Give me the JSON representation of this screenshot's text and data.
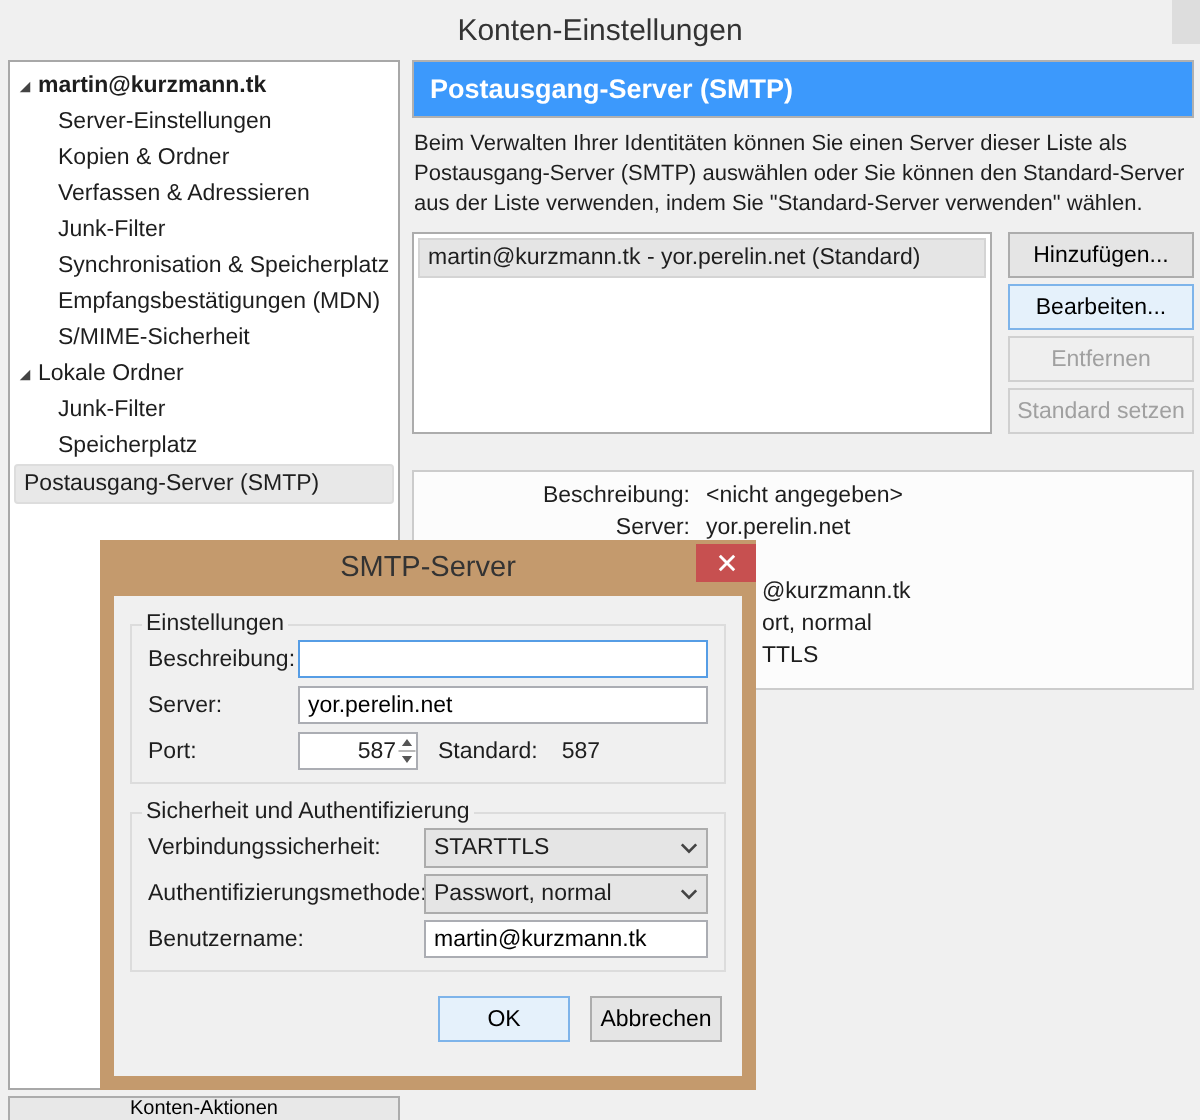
{
  "window": {
    "title": "Konten-Einstellungen"
  },
  "tree": [
    {
      "label": "martin@kurzmann.tk",
      "expanded": true,
      "selected": false,
      "children": [
        {
          "label": "Server-Einstellungen",
          "selected": false
        },
        {
          "label": "Kopien & Ordner",
          "selected": false
        },
        {
          "label": "Verfassen & Adressieren",
          "selected": false
        },
        {
          "label": "Junk-Filter",
          "selected": false
        },
        {
          "label": "Synchronisation & Speicherplatz",
          "selected": false
        },
        {
          "label": "Empfangsbestätigungen (MDN)",
          "selected": false
        },
        {
          "label": "S/MIME-Sicherheit",
          "selected": false
        }
      ]
    },
    {
      "label": "Lokale Ordner",
      "expanded": true,
      "selected": false,
      "children": [
        {
          "label": "Junk-Filter",
          "selected": false
        },
        {
          "label": "Speicherplatz",
          "selected": false
        }
      ]
    },
    {
      "label": "Postausgang-Server (SMTP)",
      "selected": true
    }
  ],
  "account_actions_button": "Konten-Aktionen",
  "panel": {
    "heading": "Postausgang-Server (SMTP)",
    "description": "Beim Verwalten Ihrer Identitäten können Sie einen Server dieser Liste als Postausgang-Server (SMTP) auswählen oder Sie können den Standard-Server aus der Liste verwenden, indem Sie \"Standard-Server verwenden\" wählen.",
    "servers": [
      {
        "label": "martin@kurzmann.tk - yor.perelin.net (Standard)",
        "selected": true
      }
    ],
    "buttons": [
      {
        "label": "Hinzufügen...",
        "disabled": false,
        "focused": false
      },
      {
        "label": "Bearbeiten...",
        "disabled": false,
        "focused": true
      },
      {
        "label": "Entfernen",
        "disabled": true,
        "focused": false
      },
      {
        "label": "Standard setzen",
        "disabled": true,
        "focused": false
      }
    ],
    "details": [
      {
        "kind": "full",
        "label": "Beschreibung:",
        "value": "<nicht angegeben>"
      },
      {
        "kind": "full",
        "label": "Server:",
        "value": "yor.perelin.net"
      },
      {
        "kind": "hidden"
      },
      {
        "kind": "cut",
        "value": "@kurzmann.tk"
      },
      {
        "kind": "cut",
        "value": "ort, normal"
      },
      {
        "kind": "cut",
        "value": "TTLS"
      }
    ]
  },
  "dialog": {
    "title": "SMTP-Server",
    "settings_group": {
      "title": "Einstellungen",
      "description_label": "Beschreibung:",
      "server_label": "Server:",
      "server_value": "yor.perelin.net",
      "port_label": "Port:",
      "port_value": "587",
      "default_label": "Standard:",
      "default_value": "587"
    },
    "security_group": {
      "title": "Sicherheit und Authentifizierung",
      "connection_label": "Verbindungssicherheit:",
      "connection_value": "STARTTLS",
      "auth_label": "Authentifizierungsmethode:",
      "auth_value": "Passwort, normal",
      "username_label": "Benutzername:",
      "username_value": "martin@kurzmann.tk"
    },
    "buttons": [
      {
        "label": "OK",
        "focused": true
      },
      {
        "label": "Abbrechen",
        "focused": false
      }
    ]
  }
}
